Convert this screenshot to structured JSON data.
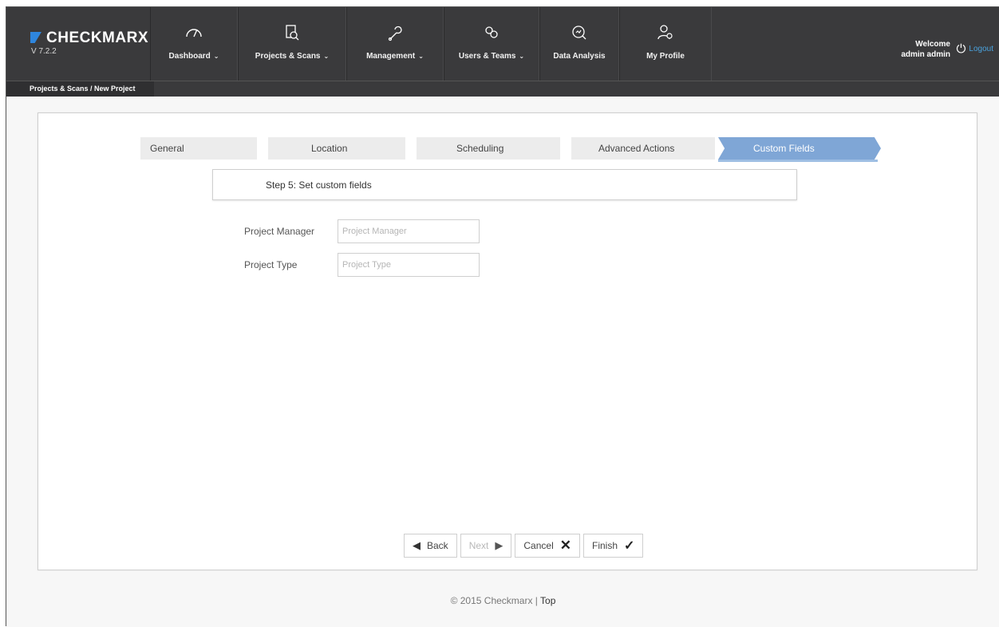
{
  "app": {
    "logo": "CHECKMARX",
    "version": "V 7.2.2"
  },
  "nav": [
    {
      "label": "Dashboard",
      "icon": "gauge-icon",
      "has_caret": true
    },
    {
      "label": "Projects & Scans",
      "icon": "projects-icon",
      "has_caret": true
    },
    {
      "label": "Management",
      "icon": "wrench-icon",
      "has_caret": true
    },
    {
      "label": "Users & Teams",
      "icon": "users-icon",
      "has_caret": true
    },
    {
      "label": "Data Analysis",
      "icon": "analysis-icon",
      "has_caret": false
    },
    {
      "label": "My Profile",
      "icon": "profile-icon",
      "has_caret": false
    }
  ],
  "caret": "⌄",
  "user": {
    "welcome": "Welcome",
    "name": "admin admin",
    "logout": "Logout",
    "logout_icon": "power-icon"
  },
  "breadcrumb": "Projects & Scans / New Project",
  "wizard": {
    "steps": [
      "General",
      "Location",
      "Scheduling",
      "Advanced Actions",
      "Custom Fields"
    ],
    "active_step": "Custom Fields",
    "step_header": "Step 5: Set custom fields"
  },
  "form": {
    "fields": [
      {
        "label": "Project Manager",
        "placeholder": "Project Manager",
        "value": ""
      },
      {
        "label": "Project Type",
        "placeholder": "Project Type",
        "value": ""
      }
    ]
  },
  "buttons": {
    "back": "Back",
    "next": "Next",
    "cancel": "Cancel",
    "finish": "Finish"
  },
  "footer": {
    "copyright": "© 2015 Checkmarx |",
    "top_link": "Top"
  },
  "colors": {
    "topbar": "#3a3a3c",
    "active_step": "#7fa6d6",
    "accent": "#4aa3df"
  }
}
